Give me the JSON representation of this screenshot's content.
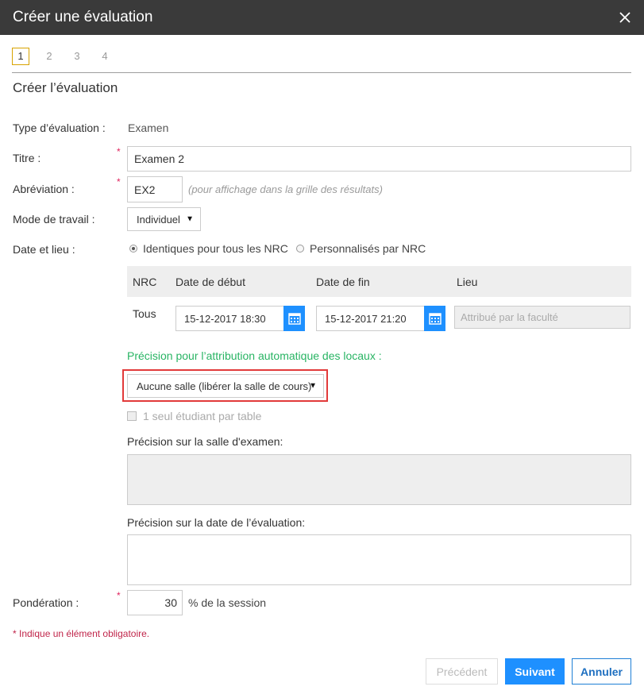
{
  "window": {
    "title": "Créer une évaluation"
  },
  "steps": [
    "1",
    "2",
    "3",
    "4"
  ],
  "section_title": "Créer l’évaluation",
  "fields": {
    "type_label": "Type d’évaluation :",
    "type_value": "Examen",
    "titre_label": "Titre :",
    "titre_value": "Examen 2",
    "abrev_label": "Abréviation :",
    "abrev_value": "EX2",
    "abrev_hint": "(pour affichage dans la grille des résultats)",
    "mode_label": "Mode de travail :",
    "mode_value": "Individuel",
    "date_label": "Date et lieu :",
    "radio_identiques": "Identiques pour tous les NRC",
    "radio_personnalises": "Personnalisés par NRC",
    "ponderation_label": "Pondération :",
    "ponderation_value": "30",
    "ponderation_unit": "% de la session"
  },
  "table": {
    "headers": [
      "NRC",
      "Date de début",
      "Date de fin",
      "Lieu"
    ],
    "row": {
      "nrc": "Tous",
      "debut": "15-12-2017 18:30",
      "fin": "15-12-2017 21:20",
      "lieu_placeholder": "Attribué par la faculté"
    }
  },
  "locaux": {
    "label": "Précision pour l’attribution automatique des locaux :",
    "select_value": "Aucune salle (libérer la salle de cours)",
    "checkbox_label": "1 seul étudiant par table",
    "salle_label": "Précision sur la salle d'examen:",
    "date_eval_label": "Précision sur la date de l’évaluation:"
  },
  "required_note": "* Indique un élément obligatoire.",
  "buttons": {
    "prev": "Précédent",
    "next": "Suivant",
    "cancel": "Annuler"
  },
  "colors": {
    "accent": "#1e90ff",
    "green": "#28b463",
    "required": "#e0245e",
    "highlight": "#e23a3a"
  }
}
